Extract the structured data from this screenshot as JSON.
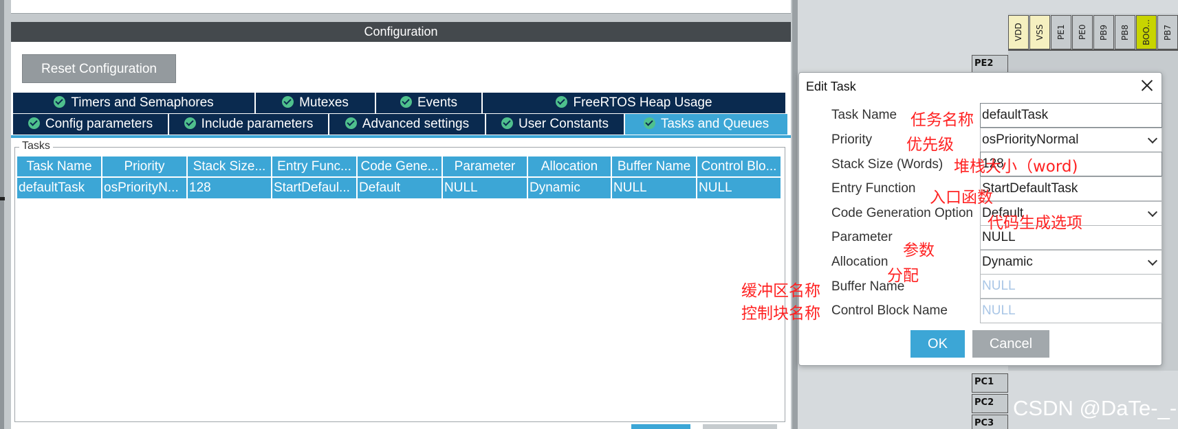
{
  "config": {
    "title": "Configuration",
    "reset_label": "Reset Configuration",
    "tabs_row1": [
      "Timers and Semaphores",
      "Mutexes",
      "Events",
      "FreeRTOS Heap Usage"
    ],
    "tabs_row2": [
      "Config parameters",
      "Include parameters",
      "Advanced settings",
      "User Constants",
      "Tasks and Queues"
    ],
    "active_tab": "Tasks and Queues",
    "tasks_group_label": "Tasks",
    "table": {
      "headers": [
        "Task Name",
        "Priority",
        "Stack Size...",
        "Entry Func...",
        "Code Gene...",
        "Parameter",
        "Allocation",
        "Buffer Name",
        "Control Blo..."
      ],
      "rows": [
        [
          "defaultTask",
          "osPriorityN...",
          "128",
          "StartDefaul...",
          "Default",
          "NULL",
          "Dynamic",
          "NULL",
          "NULL"
        ]
      ]
    }
  },
  "pinout": {
    "top_pins": [
      "VDD",
      "VSS",
      "PE1",
      "PE0",
      "PB9",
      "PB8",
      "BOO...",
      "PB7"
    ],
    "left_pins": [
      "PE2",
      "PC1",
      "PC2",
      "PC3"
    ]
  },
  "dialog": {
    "title": "Edit Task",
    "fields": [
      {
        "label": "Task Name",
        "value": "defaultTask"
      },
      {
        "label": "Priority",
        "value": "osPriorityNormal"
      },
      {
        "label": "Stack Size (Words)",
        "value": "128"
      },
      {
        "label": "Entry Function",
        "value": "StartDefaultTask"
      },
      {
        "label": "Code Generation Option",
        "value": "Default"
      },
      {
        "label": "Parameter",
        "value": "NULL"
      },
      {
        "label": "Allocation",
        "value": "Dynamic"
      },
      {
        "label": "Buffer Name",
        "value": "NULL"
      },
      {
        "label": "Control Block Name",
        "value": "NULL"
      }
    ],
    "ok_label": "OK",
    "cancel_label": "Cancel"
  },
  "annotations": {
    "task_name": "任务名称",
    "priority": "优先级",
    "stack_size": "堆栈大小（word)",
    "entry_function": "入口函数",
    "code_generation": "代码生成选项",
    "parameter": "参数",
    "allocation": "分配",
    "buffer_name": "缓冲区名称",
    "control_block": "控制块名称"
  },
  "watermark": "CSDN @DaTe-_-",
  "colors": {
    "accent": "#3ca6d6",
    "tab_dark": "#0a2a4f",
    "check_green": "#4fc08d",
    "annotation_red": "#ff2222",
    "boot_pin_yellow": "#c8d400",
    "power_pin_yellow": "#f5f0c0"
  }
}
